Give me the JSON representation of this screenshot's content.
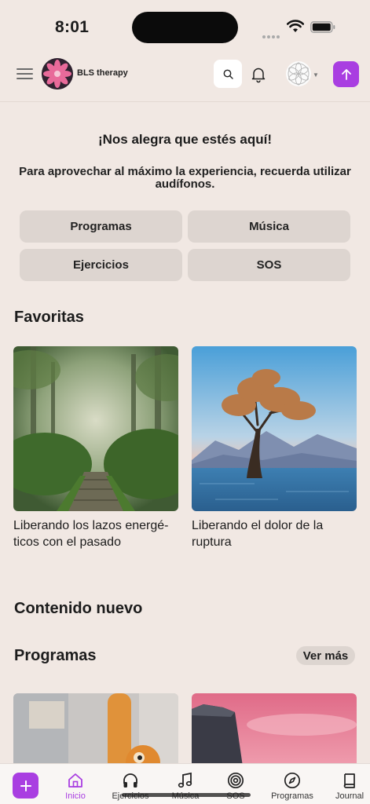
{
  "status_bar": {
    "time": "8:01"
  },
  "header": {
    "brand": "BLS therapy",
    "icons": {
      "menu": "hamburger-menu-icon",
      "logo": "lotus-logo-icon",
      "search": "search-icon",
      "notifications": "bell-icon",
      "profile": "mandala-avatar",
      "upload": "arrow-up-icon"
    }
  },
  "welcome": {
    "title": "¡Nos alegra que estés aquí!",
    "tip": "Para aprovechar al máximo la experiencia, recuerda utilizar audífonos."
  },
  "category_buttons": [
    "Programas",
    "Música",
    "Ejercicios",
    "SOS"
  ],
  "favoritas": {
    "title": "Favoritas",
    "cards": [
      {
        "title": "Liberando los lazos energé-ticos con el pasado",
        "line1": "Liberando los lazos energé-",
        "line2": "ticos con el pasado"
      },
      {
        "title": "Liberando el dolor de la ruptura",
        "line1": "Liberando el dolor de la",
        "line2": "ruptura"
      }
    ]
  },
  "contenido_nuevo": {
    "title": "Contenido nuevo"
  },
  "programas": {
    "title": "Programas",
    "see_more": "Ver más"
  },
  "tab_bar": {
    "add_icon": "plus-icon",
    "tabs": [
      {
        "label": "Inicio",
        "icon": "home-icon",
        "active": true
      },
      {
        "label": "Ejercicios",
        "icon": "headphones-icon",
        "active": false
      },
      {
        "label": "Música",
        "icon": "music-note-icon",
        "active": false
      },
      {
        "label": "SOS",
        "icon": "target-icon",
        "active": false
      },
      {
        "label": "Programas",
        "icon": "compass-icon",
        "active": false
      },
      {
        "label": "Journal",
        "icon": "book-icon",
        "active": false
      }
    ]
  },
  "colors": {
    "accent": "#a93ee1",
    "background": "#f1e8e3",
    "button": "#ddd5d0"
  }
}
